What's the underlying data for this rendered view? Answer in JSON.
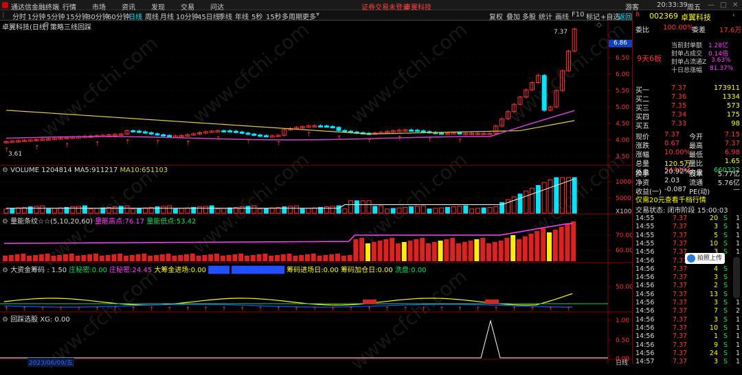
{
  "menubar": {
    "app_name": "通达信金融终端",
    "items": [
      "行情",
      "市场",
      "资讯",
      "发现",
      "交易",
      "问达"
    ],
    "notice": "证券交易未登录",
    "stock_name": "卓翼科技",
    "right_items": [
      "游客",
      "20:33:39",
      "周五"
    ]
  },
  "toolbar": {
    "periods": [
      "分时",
      "1分钟",
      "5分钟",
      "15分钟",
      "30分钟",
      "60分钟",
      "日线",
      "周线",
      "月线",
      "10分钟",
      "45日线",
      "季线",
      "年线",
      "5秒",
      "15秒",
      "多周期",
      "更多"
    ],
    "active": "日线",
    "right_items": [
      "复权",
      "叠加",
      "多股",
      "统计",
      "画线",
      "F10",
      "标记",
      "+自选",
      "返回"
    ]
  },
  "titlebar": {
    "stock": "卓翼科技(日线)",
    "indicator": "策略三线回踩"
  },
  "main_chart": {
    "price_labels": [
      "6.50",
      "6.00",
      "5.50",
      "5.00",
      "4.50",
      "4.00",
      "3.50"
    ],
    "current_price_tag": "6.86",
    "high_label": "7.37",
    "low_label": "3.61"
  },
  "volume_panel": {
    "title": "VOLUME",
    "volume": "1204814",
    "ma5_label": "MA5:",
    "ma5": "911217",
    "ma10_label": "MA10:",
    "ma10": "651103",
    "axis": [
      "10000",
      "5000"
    ],
    "unit": "X100"
  },
  "panel3": {
    "title": "量能条纹☆☆(5,10,20,60)",
    "label1": "量能高点:",
    "value1": "76.17",
    "label2": "量能低点:",
    "value2": "53.42",
    "axis": [
      "70.00",
      "60.00"
    ]
  },
  "panel4": {
    "title": "大资金筹码 : 1.50",
    "items": [
      {
        "label": "庄秘密:",
        "value": "0.00"
      },
      {
        "label": "庄秘密:",
        "value": "24.45"
      },
      {
        "label": "大筹金进场:",
        "value": "0.00"
      },
      {
        "label": "筹码进场日:",
        "value": "0.00"
      },
      {
        "label": "筹码加仓日:",
        "value": "0.00"
      },
      {
        "label": "洗盘:",
        "value": "0.00"
      }
    ],
    "axis": [
      "50.00"
    ]
  },
  "panel5": {
    "title": "回踩选股 XG: 0.00",
    "axis": [
      "1.00",
      "0.50",
      "0.00"
    ]
  },
  "bottom": {
    "date_label": "2023/06/09/五",
    "right_label": "日线"
  },
  "quote": {
    "code": "002369",
    "name": "卓翼科技",
    "weibi_label": "委比",
    "weibi": "100.00%",
    "weicha_label": "委差",
    "weicha": "17.6万",
    "badge": "9天6板",
    "info": [
      {
        "label": "当前封单额",
        "value": "1.28亿"
      },
      {
        "label": "封单占成交",
        "value": "0.14倍"
      },
      {
        "label": "封单占流通Z",
        "value": "3.63%"
      },
      {
        "label": "十日总涨幅",
        "value": "81.37%"
      }
    ],
    "buys": [
      {
        "label": "买一",
        "price": "7.37",
        "vol": "173911"
      },
      {
        "label": "买二",
        "price": "7.36",
        "vol": "1334"
      },
      {
        "label": "买三",
        "price": "7.35",
        "vol": "573"
      },
      {
        "label": "买四",
        "price": "7.34",
        "vol": "175"
      },
      {
        "label": "买五",
        "price": "7.33",
        "vol": "98"
      }
    ],
    "stats": [
      {
        "l1": "现价",
        "v1": "7.37",
        "l2": "今开",
        "v2": "7.15"
      },
      {
        "l1": "涨跌",
        "v1": "0.67",
        "l2": "最高",
        "v2": "7.37"
      },
      {
        "l1": "涨幅",
        "v1": "10.00%",
        "l2": "最低",
        "v2": "6.98"
      },
      {
        "l1": "总量",
        "v1": "120.5万",
        "l2": "量比",
        "v2": "1.65"
      },
      {
        "l1": "外盘",
        "v1": "544492",
        "l2": "内盘",
        "v2": "660322"
      }
    ],
    "stats2": [
      {
        "l1": "换手",
        "v1": "20.92%",
        "l2": "股本",
        "v2": "5.77亿"
      },
      {
        "l1": "净资",
        "v1": "2.03",
        "l2": "流通",
        "v2": "5.76亿"
      },
      {
        "l1": "收益(一)",
        "v1": "-0.087",
        "l2": "PE(动)",
        "v2": "—"
      }
    ],
    "promo": "仅需20元查看千档行情",
    "trade_state": "交易状态: 闭市阶段 15:00:03",
    "ticks": [
      {
        "t": "14:55",
        "p": "7.37",
        "v": "20",
        "d": "S",
        "n": "1"
      },
      {
        "t": "14:55",
        "p": "7.37",
        "v": "3",
        "d": "S",
        "n": "1"
      },
      {
        "t": "14:55",
        "p": "7.37",
        "v": "5",
        "d": "S",
        "n": "1"
      },
      {
        "t": "14:55",
        "p": "7.37",
        "v": "10",
        "d": "S",
        "n": "1"
      },
      {
        "t": "14:56",
        "p": "7.37",
        "v": "3",
        "d": "S",
        "n": "1"
      },
      {
        "t": "14:56",
        "p": "7.37",
        "v": "",
        "d": "",
        "n": "1"
      },
      {
        "t": "14:56",
        "p": "7.37",
        "v": "4",
        "d": "S",
        "n": "1"
      },
      {
        "t": "14:56",
        "p": "7.37",
        "v": "3",
        "d": "S",
        "n": "1"
      },
      {
        "t": "14:56",
        "p": "7.37",
        "v": "2",
        "d": "S",
        "n": "1"
      },
      {
        "t": "14:56",
        "p": "7.37",
        "v": "13",
        "d": "S",
        "n": "1"
      },
      {
        "t": "14:56",
        "p": "7.37",
        "v": "3",
        "d": "S",
        "n": "1"
      },
      {
        "t": "14:56",
        "p": "7.37",
        "v": "7",
        "d": "S",
        "n": "2"
      },
      {
        "t": "14:56",
        "p": "7.37",
        "v": "3",
        "d": "S",
        "n": "1"
      },
      {
        "t": "14:56",
        "p": "7.37",
        "v": "10",
        "d": "S",
        "n": "1"
      },
      {
        "t": "14:56",
        "p": "7.37",
        "v": "1",
        "d": "S",
        "n": "1"
      },
      {
        "t": "14:56",
        "p": "7.37",
        "v": "9",
        "d": "S",
        "n": "1"
      },
      {
        "t": "14:56",
        "p": "7.37",
        "v": "24",
        "d": "S",
        "n": "1"
      },
      {
        "t": "14:57",
        "p": "7.37",
        "v": "3",
        "d": "S",
        "n": "1"
      }
    ],
    "float_button": "拍照上传"
  },
  "colors": {
    "up": "#ff3333",
    "down": "#00e5ff",
    "ma_yellow": "#e0d040",
    "ma_magenta": "#d040d0"
  }
}
